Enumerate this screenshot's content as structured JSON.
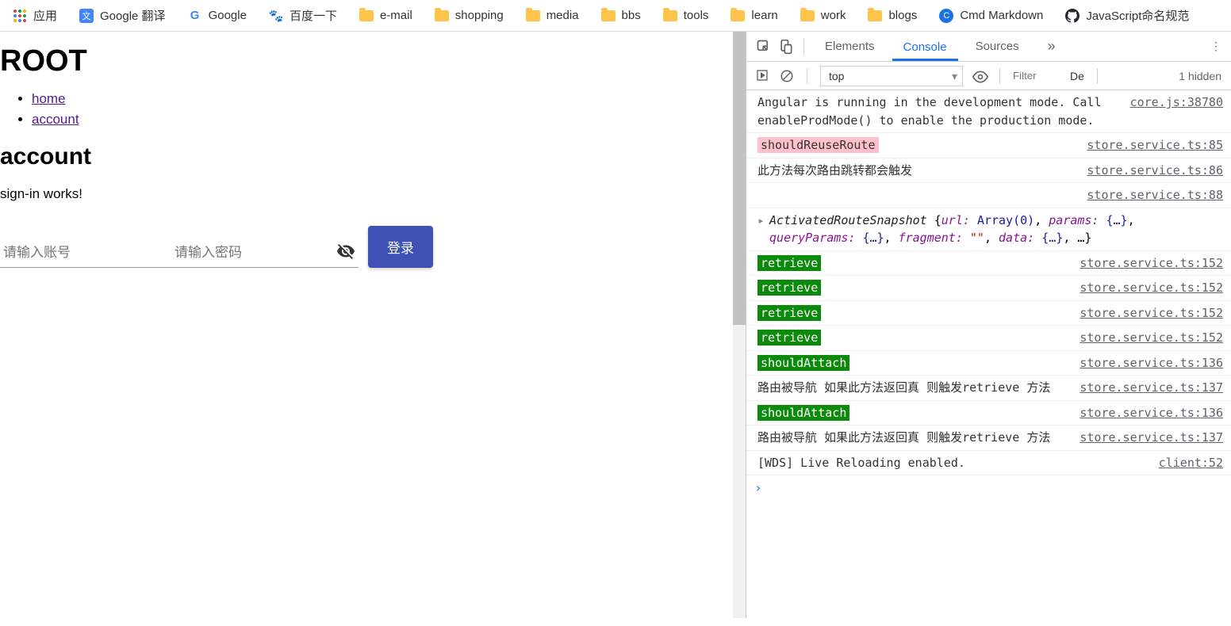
{
  "bookmarks": {
    "apps": "应用",
    "items": [
      {
        "label": "Google 翻译",
        "icon": "translate"
      },
      {
        "label": "Google",
        "icon": "google"
      },
      {
        "label": "百度一下",
        "icon": "baidu"
      },
      {
        "label": "e-mail",
        "icon": "folder"
      },
      {
        "label": "shopping",
        "icon": "folder"
      },
      {
        "label": "media",
        "icon": "folder"
      },
      {
        "label": "bbs",
        "icon": "folder"
      },
      {
        "label": "tools",
        "icon": "folder"
      },
      {
        "label": "learn",
        "icon": "folder"
      },
      {
        "label": "work",
        "icon": "folder"
      },
      {
        "label": "blogs",
        "icon": "folder"
      },
      {
        "label": "Cmd Markdown",
        "icon": "cmd"
      },
      {
        "label": "JavaScript命名规范",
        "icon": "github"
      }
    ]
  },
  "page": {
    "title": "ROOT",
    "nav": {
      "home": "home",
      "account": "account"
    },
    "section_title": "account",
    "signin_text": "sign-in works!",
    "placeholder_user": "请输入账号",
    "placeholder_pass": "请输入密码",
    "login_button": "登录"
  },
  "devtools": {
    "tabs": {
      "elements": "Elements",
      "console": "Console",
      "sources": "Sources"
    },
    "toolbar": {
      "context": "top",
      "filter_placeholder": "Filter",
      "levels": "De",
      "hidden": "1 hidden"
    },
    "console": [
      {
        "msg": "Angular is running in the development mode. Call enableProdMode() to enable the production mode.",
        "src": "core.js:38780",
        "type": "plain"
      },
      {
        "msg": "shouldReuseRoute",
        "src": "store.service.ts:85",
        "type": "pink"
      },
      {
        "msg": "此方法每次路由跳转都会触发",
        "src": "store.service.ts:86",
        "type": "plain"
      },
      {
        "msg": "",
        "src": "store.service.ts:88",
        "type": "src-only"
      },
      {
        "msg_obj": "ActivatedRouteSnapshot {url: Array(0), params: {…}, queryParams: {…}, fragment: \"\", data: {…}, …}",
        "type": "object"
      },
      {
        "msg": "retrieve",
        "src": "store.service.ts:152",
        "type": "green"
      },
      {
        "msg": "retrieve",
        "src": "store.service.ts:152",
        "type": "green"
      },
      {
        "msg": "retrieve",
        "src": "store.service.ts:152",
        "type": "green"
      },
      {
        "msg": "retrieve",
        "src": "store.service.ts:152",
        "type": "green"
      },
      {
        "msg": "shouldAttach",
        "src": "store.service.ts:136",
        "type": "green"
      },
      {
        "msg": "路由被导航 如果此方法返回真 则触发retrieve 方法",
        "src": "store.service.ts:137",
        "type": "plain"
      },
      {
        "msg": "shouldAttach",
        "src": "store.service.ts:136",
        "type": "green"
      },
      {
        "msg": "路由被导航 如果此方法返回真 则触发retrieve 方法",
        "src": "store.service.ts:137",
        "type": "plain"
      },
      {
        "msg": "[WDS] Live Reloading enabled.",
        "src": "client:52",
        "type": "plain"
      }
    ],
    "prompt": "›"
  }
}
